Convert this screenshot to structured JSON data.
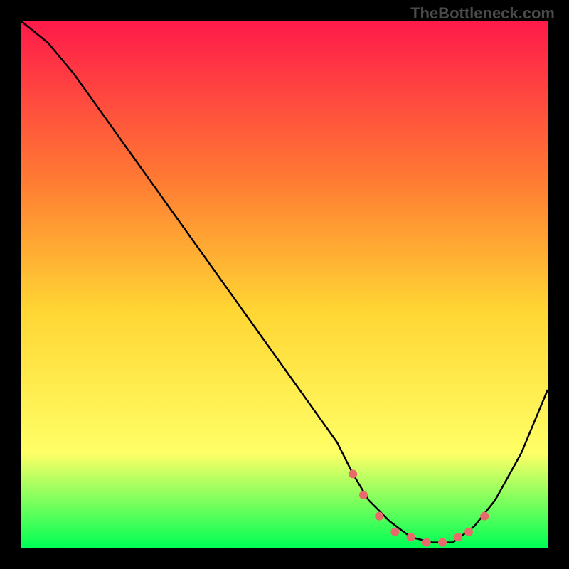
{
  "watermark": "TheBottleneck.com",
  "chart_data": {
    "type": "line",
    "title": "",
    "xlabel": "",
    "ylabel": "",
    "xlim": [
      0,
      100
    ],
    "ylim": [
      0,
      100
    ],
    "gradient_colors": {
      "top": "#ff1a4a",
      "upper_mid": "#ff7a33",
      "mid": "#ffd633",
      "lower_mid": "#ffff66",
      "bottom": "#00ff55"
    },
    "series": [
      {
        "name": "bottleneck-curve",
        "color": "#000000",
        "x": [
          0,
          5,
          10,
          15,
          20,
          25,
          30,
          35,
          40,
          45,
          50,
          55,
          60,
          63,
          66,
          70,
          74,
          78,
          82,
          86,
          90,
          95,
          100
        ],
        "y": [
          100,
          96,
          90,
          83,
          76,
          69,
          62,
          55,
          48,
          41,
          34,
          27,
          20,
          14,
          9,
          5,
          2,
          1,
          1,
          4,
          9,
          18,
          30
        ]
      }
    ],
    "markers": {
      "name": "highlight-dots",
      "color": "#e86a6a",
      "x": [
        63,
        65,
        68,
        71,
        74,
        77,
        80,
        83,
        85,
        88
      ],
      "y": [
        14,
        10,
        6,
        3,
        2,
        1,
        1,
        2,
        3,
        6
      ]
    }
  }
}
